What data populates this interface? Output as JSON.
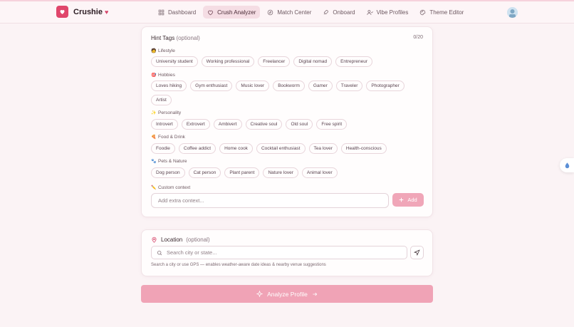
{
  "brand": {
    "name": "Crushie",
    "heart": "♥"
  },
  "nav": [
    {
      "label": "Dashboard",
      "icon": "grid-icon"
    },
    {
      "label": "Crush Analyzer",
      "icon": "heart-icon",
      "active": true
    },
    {
      "label": "Match Center",
      "icon": "compass-icon"
    },
    {
      "label": "Onboard",
      "icon": "rocket-icon"
    },
    {
      "label": "Vibe Profiles",
      "icon": "users-icon"
    },
    {
      "label": "Theme Editor",
      "icon": "palette-icon"
    }
  ],
  "hint_tags": {
    "title": "Hint Tags",
    "optional": "(optional)",
    "counter": "0/20",
    "categories": [
      {
        "label": "Lifestyle",
        "emoji": "🧑",
        "tags": [
          "University student",
          "Working professional",
          "Freelancer",
          "Digital nomad",
          "Entrepreneur"
        ]
      },
      {
        "label": "Hobbies",
        "emoji": "🎯",
        "tags": [
          "Loves hiking",
          "Gym enthusiast",
          "Music lover",
          "Bookworm",
          "Gamer",
          "Traveler",
          "Photographer"
        ],
        "tags_row2": [
          "Artist"
        ]
      },
      {
        "label": "Personality",
        "emoji": "✨",
        "tags": [
          "Introvert",
          "Extrovert",
          "Ambivert",
          "Creative soul",
          "Old soul",
          "Free spirit"
        ]
      },
      {
        "label": "Food & Drink",
        "emoji": "🍕",
        "tags": [
          "Foodie",
          "Coffee addict",
          "Home cook",
          "Cocktail enthusiast",
          "Tea lover",
          "Health-conscious"
        ]
      },
      {
        "label": "Pets & Nature",
        "emoji": "🐾",
        "tags": [
          "Dog person",
          "Cat person",
          "Plant parent",
          "Nature lover",
          "Animal lover"
        ]
      }
    ],
    "custom_context_label": "Custom context",
    "custom_context_emoji": "✏️",
    "custom_placeholder": "Add extra context...",
    "add_label": "Add"
  },
  "location": {
    "title": "Location",
    "optional": "(optional)",
    "search_placeholder": "Search city or state...",
    "help": "Search a city or use GPS — enables weather-aware date ideas & nearby venue suggestions"
  },
  "analyze_label": "Analyze Profile",
  "colors": {
    "accent": "#e0466b",
    "button": "#f0a3b6",
    "active_nav": "#f5dde4"
  }
}
